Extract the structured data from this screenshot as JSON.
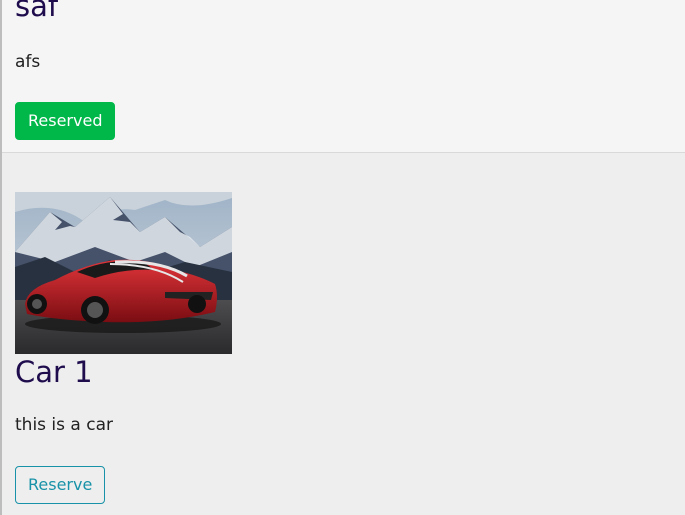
{
  "listings": [
    {
      "title": "saf",
      "description": "afs",
      "button_label": "Reserved",
      "button_state": "reserved",
      "button_color": "#00b74a"
    },
    {
      "title": "Car 1",
      "description": "this is a car",
      "button_label": "Reserve",
      "button_state": "available",
      "button_color": "#1892a8",
      "image": "red-sports-car-photo"
    }
  ],
  "colors": {
    "title_text": "#1e0c4d",
    "body_text": "#212121",
    "page_background": "#eeeeee"
  }
}
